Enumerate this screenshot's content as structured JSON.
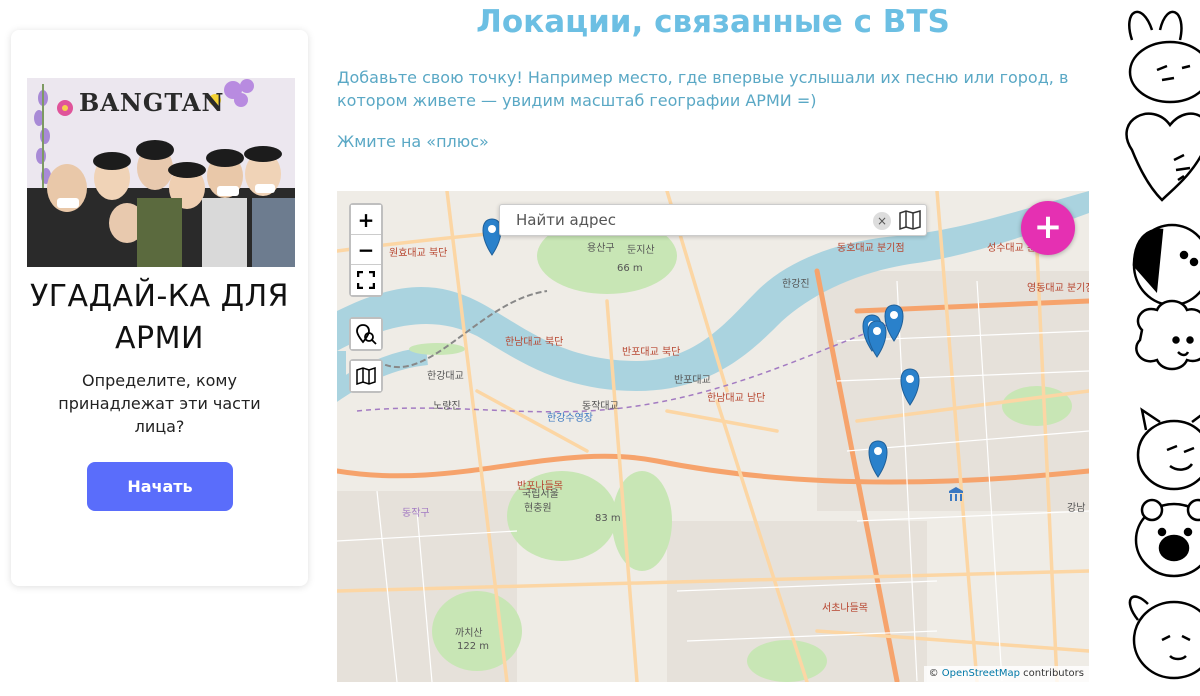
{
  "card": {
    "photo_text": "BANGTAN",
    "title": "УГАДАЙ-КА ДЛЯ АРМИ",
    "description": "Определите, кому принадлежат эти части лица?",
    "start_label": "Начать"
  },
  "page": {
    "title": "Локации, связанные с BTS",
    "intro": "Добавьте свою точку! Например место, где впервые услышали их песню или город, в котором живете — увидим масштаб географии АРМИ =)",
    "hint": "Жмите на «плюс»"
  },
  "map": {
    "search_placeholder": "Найти адрес",
    "clear_glyph": "×",
    "zoom_in": "+",
    "zoom_out": "−",
    "add_glyph": "+",
    "attribution_prefix": "© ",
    "attribution_link": "OpenStreetMap",
    "attribution_suffix": " contributors",
    "icons": [
      "plus-icon",
      "minus-icon",
      "fullscreen-icon",
      "search-location-icon",
      "book-map-icon",
      "map-marker-icon"
    ],
    "marker_count": 6,
    "place_labels": [
      "원효대교 북단",
      "용산구",
      "둔지산",
      "66 m",
      "한강진",
      "동호대교 분기점",
      "성수대교 분기점",
      "영동대교 분기점",
      "한강대교",
      "노량진",
      "한남대교 북단",
      "반포대교 북단",
      "한남대교 남단",
      "반포대교",
      "동작대교",
      "동작구",
      "국립서울",
      "현충원",
      "83 m",
      "반포나들목",
      "서초나들목",
      "까치산",
      "122 m",
      "한강수영장",
      "강남"
    ],
    "colors": {
      "water": "#aad3df",
      "park": "#c8e6b5",
      "road": "#fcd6a4",
      "trunk": "#f6a36c",
      "marker": "#2a81cb"
    }
  },
  "colors": {
    "accent": "#6cbfe3",
    "button": "#5a6dfb",
    "add": "#e530b2",
    "text_link": "#5aa8c5"
  }
}
